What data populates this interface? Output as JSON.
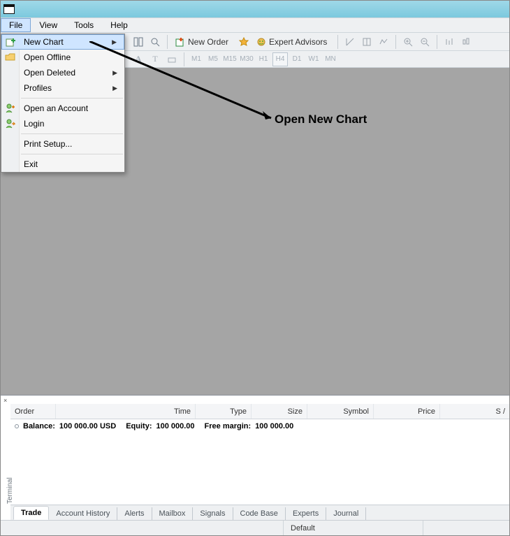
{
  "title": "",
  "menubar": {
    "items": [
      "File",
      "View",
      "Tools",
      "Help"
    ],
    "active_index": 0
  },
  "toolbar": {
    "new_order": "New Order",
    "expert_advisors": "Expert Advisors"
  },
  "timeframes": [
    "M1",
    "M5",
    "M15",
    "M30",
    "H1",
    "H4",
    "D1",
    "W1",
    "MN"
  ],
  "timeframe_selected": "H4",
  "file_menu": {
    "items": [
      {
        "label": "New Chart",
        "icon": "plus-chart",
        "submenu": true,
        "highlight": true
      },
      {
        "label": "Open Offline",
        "icon": "folder"
      },
      {
        "label": "Open Deleted",
        "submenu": true
      },
      {
        "label": "Profiles",
        "submenu": true
      },
      {
        "sep": true
      },
      {
        "label": "Open an Account",
        "icon": "user-add"
      },
      {
        "label": "Login",
        "icon": "user-login"
      },
      {
        "sep": true
      },
      {
        "label": "Print Setup..."
      },
      {
        "sep": true
      },
      {
        "label": "Exit"
      }
    ]
  },
  "annotation": "Open New Chart",
  "terminal": {
    "label": "Terminal",
    "columns": [
      "Order",
      "Time",
      "Type",
      "Size",
      "Symbol",
      "Price",
      "S /"
    ],
    "balance_line": {
      "balance_label": "Balance:",
      "balance_value": "100 000.00 USD",
      "equity_label": "Equity:",
      "equity_value": "100 000.00",
      "free_margin_label": "Free margin:",
      "free_margin_value": "100 000.00"
    },
    "tabs": [
      "Trade",
      "Account History",
      "Alerts",
      "Mailbox",
      "Signals",
      "Code Base",
      "Experts",
      "Journal"
    ],
    "active_tab": "Trade"
  },
  "statusbar": {
    "default": "Default"
  }
}
